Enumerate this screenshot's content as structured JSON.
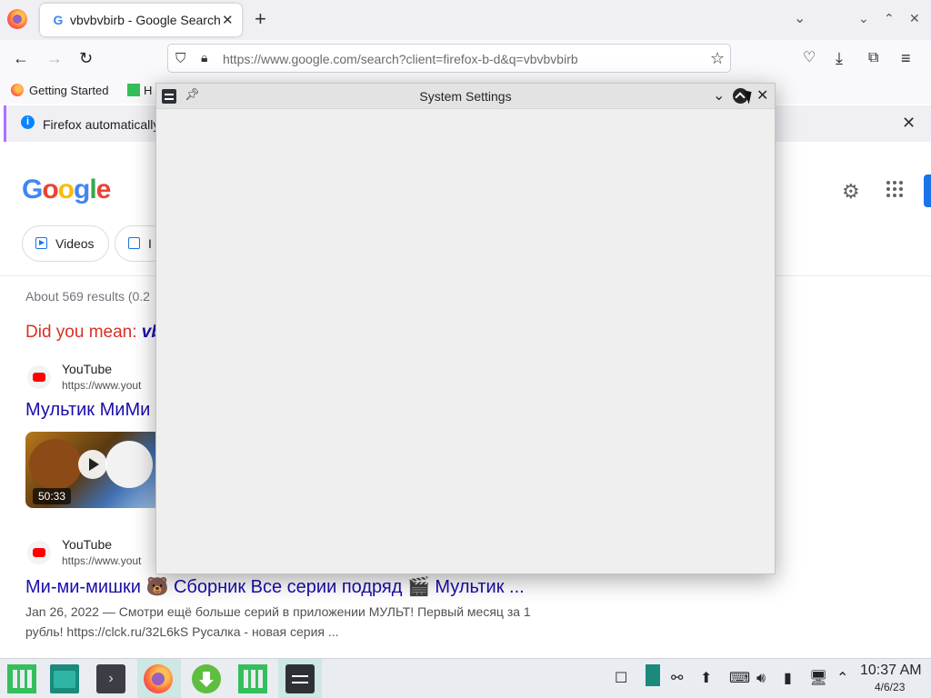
{
  "browser": {
    "tab_title": "vbvbvbirb - Google Search",
    "tab_favicon": "G",
    "tab_close": "✕",
    "new_tab": "+",
    "url": "https://www.google.com/search?client=firefox-b-d&q=vbvbvbirb",
    "bookmarks": [
      {
        "label": "Getting Started"
      },
      {
        "label": "H"
      }
    ],
    "notification_text": "Firefox automatically",
    "notification_close": "✕"
  },
  "google": {
    "logo": [
      "G",
      "o",
      "o",
      "g",
      "l",
      "e"
    ],
    "logo_colors": [
      "#4285F4",
      "#EA4335",
      "#FBBC05",
      "#4285F4",
      "#34A853",
      "#EA4335"
    ],
    "chips": [
      {
        "label": "Videos"
      },
      {
        "label": "I"
      }
    ],
    "results_stats": "About 569 results (0.2",
    "did_you_mean_prefix": "Did you mean: ",
    "did_you_mean_term": "vb",
    "results": [
      {
        "site": "YouTube",
        "url": "https://www.yout",
        "title": "Мультик МиМи"
      },
      {
        "site": "YouTube",
        "url": "https://www.yout",
        "title": "Ми-ми-мишки 🐻 Сборник Все серии подряд 🎬 Мультик ..."
      }
    ],
    "video_duration": "50:33",
    "snippet": "Jan 26, 2022 — Смотри ещё больше серий в приложении МУЛЬТ! Первый месяц за 1 рубль! https://clck.ru/32L6kS Русалка - новая серия ..."
  },
  "settings_window": {
    "title": "System Settings"
  },
  "taskbar": {
    "time": "10:37 AM",
    "date": "4/6/23"
  },
  "colors": {
    "accent_blue": "#1a0dab",
    "did_you_mean_red": "#d93025",
    "manjaro_green": "#35bf5c"
  }
}
